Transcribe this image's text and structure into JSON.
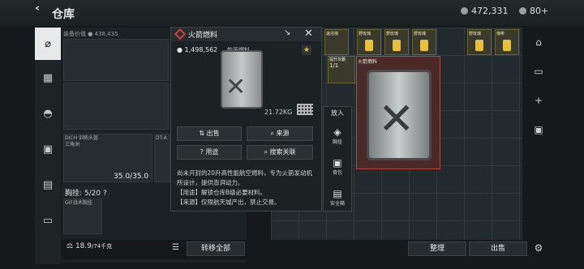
{
  "topbar": {
    "back_icon": "back-arrow-icon",
    "title": "仓库",
    "coins": "472,331",
    "gems": "80",
    "gems_plus": "+"
  },
  "leftnav": {
    "items": [
      "weapon-icon",
      "armor-icon",
      "helmet-icon",
      "backpack-icon",
      "chest-icon",
      "bag-icon"
    ]
  },
  "equip": {
    "value_label": "装备价值",
    "value": "438,435",
    "helmet_name": "DICH 训练头盔",
    "helmet_sub": "三角洲",
    "armor_name": "DT-A",
    "armor_sub": "三角",
    "durability": "35.0/35.0",
    "chest_label": "胸挂: 5/20",
    "chest_help": "?",
    "rig_name": "GIF战术胸挂",
    "rig_sub": "战术胸挂",
    "weight": "18.9",
    "weight_limit": "/74千克",
    "transfer_all": "转移全部"
  },
  "popup": {
    "title": "火箭燃料",
    "price": "1,498,562",
    "category": "能源燃料",
    "weight": "21.72KG",
    "star": "★",
    "sell": "出售",
    "source": "来源",
    "use": "用途",
    "search_link": "搜索关联",
    "desc": "尚未开封的20升高性能航空燃料，专为火箭发动机所设计，提供澎湃动力。\n【用途】解锁仓库B级必要材料。\n【来源】仅限航天城产出，禁止交易。"
  },
  "putpanel": {
    "title": "放入",
    "items": [
      {
        "icon": "rig-icon",
        "label": "胸挂"
      },
      {
        "icon": "backpack-icon",
        "label": "背包"
      },
      {
        "icon": "safebox-icon",
        "label": "安全箱"
      }
    ]
  },
  "storage": {
    "items": [
      "速溶咖",
      "野玫瑰",
      "野玫瑰",
      "野玫瑰",
      "野玫瑰",
      "咖啡"
    ],
    "small_item": "提升灰霸",
    "small_count": "1/1",
    "big_item": "火箭燃料",
    "sort": "整理",
    "sell": "出售"
  },
  "rightnav": {
    "items": [
      "home-icon",
      "tab-icon",
      "plus-icon",
      "lock-icon",
      "settings-icon"
    ]
  }
}
